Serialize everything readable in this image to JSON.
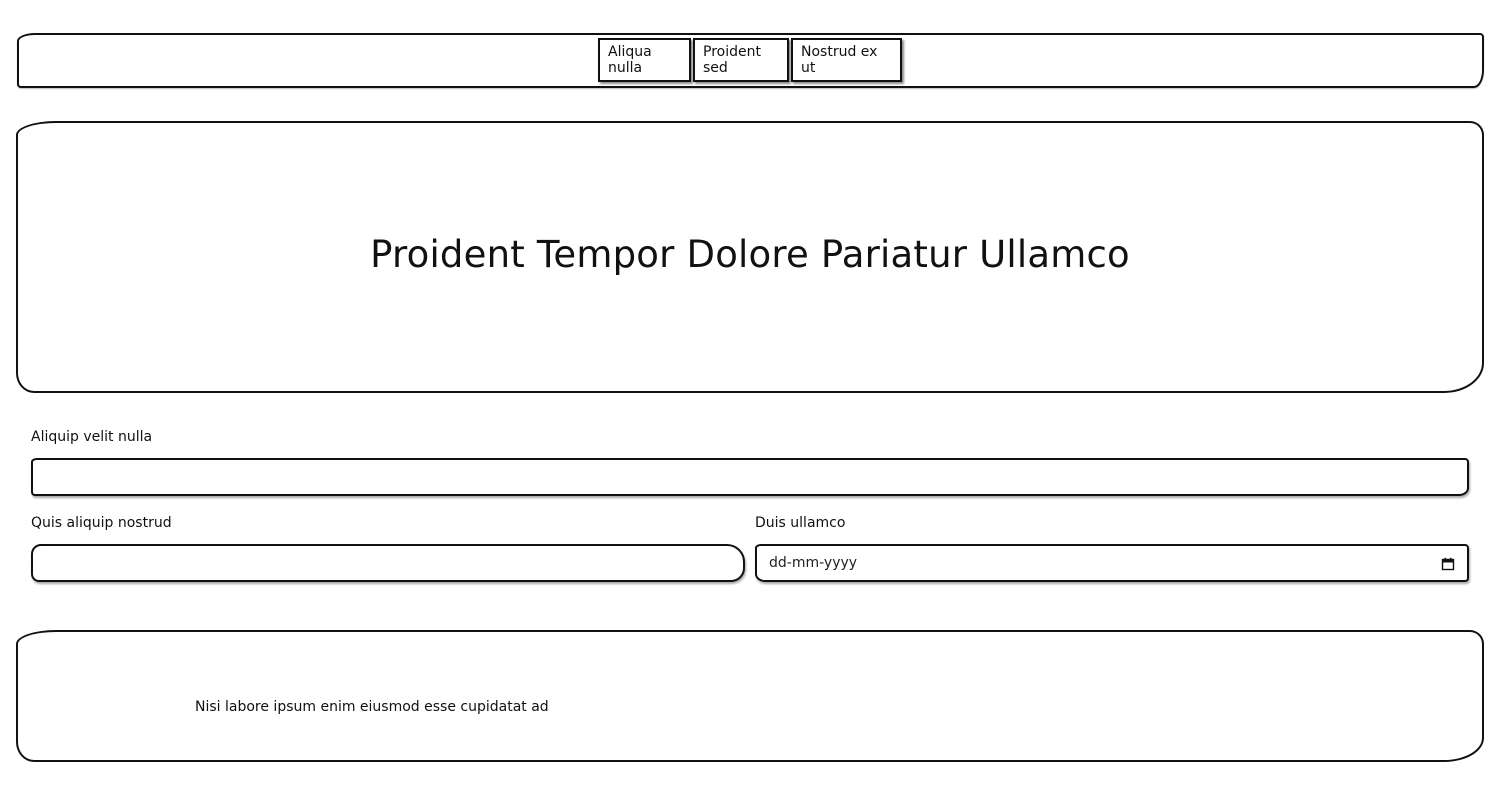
{
  "nav": {
    "items": [
      {
        "label": "Aliqua nulla"
      },
      {
        "label": "Proident sed"
      },
      {
        "label": "Nostrud ex ut"
      }
    ]
  },
  "hero": {
    "title": "Proident Tempor Dolore Pariatur Ullamco"
  },
  "form": {
    "field1": {
      "label": "Aliquip velit nulla",
      "value": ""
    },
    "field2": {
      "label": "Quis aliquip nostrud",
      "value": ""
    },
    "field3": {
      "label": "Duis ullamco",
      "placeholder": "dd-mm-yyyy",
      "icon": "calendar-icon"
    }
  },
  "footer": {
    "text": "Nisi labore ipsum enim eiusmod esse cupidatat ad"
  }
}
